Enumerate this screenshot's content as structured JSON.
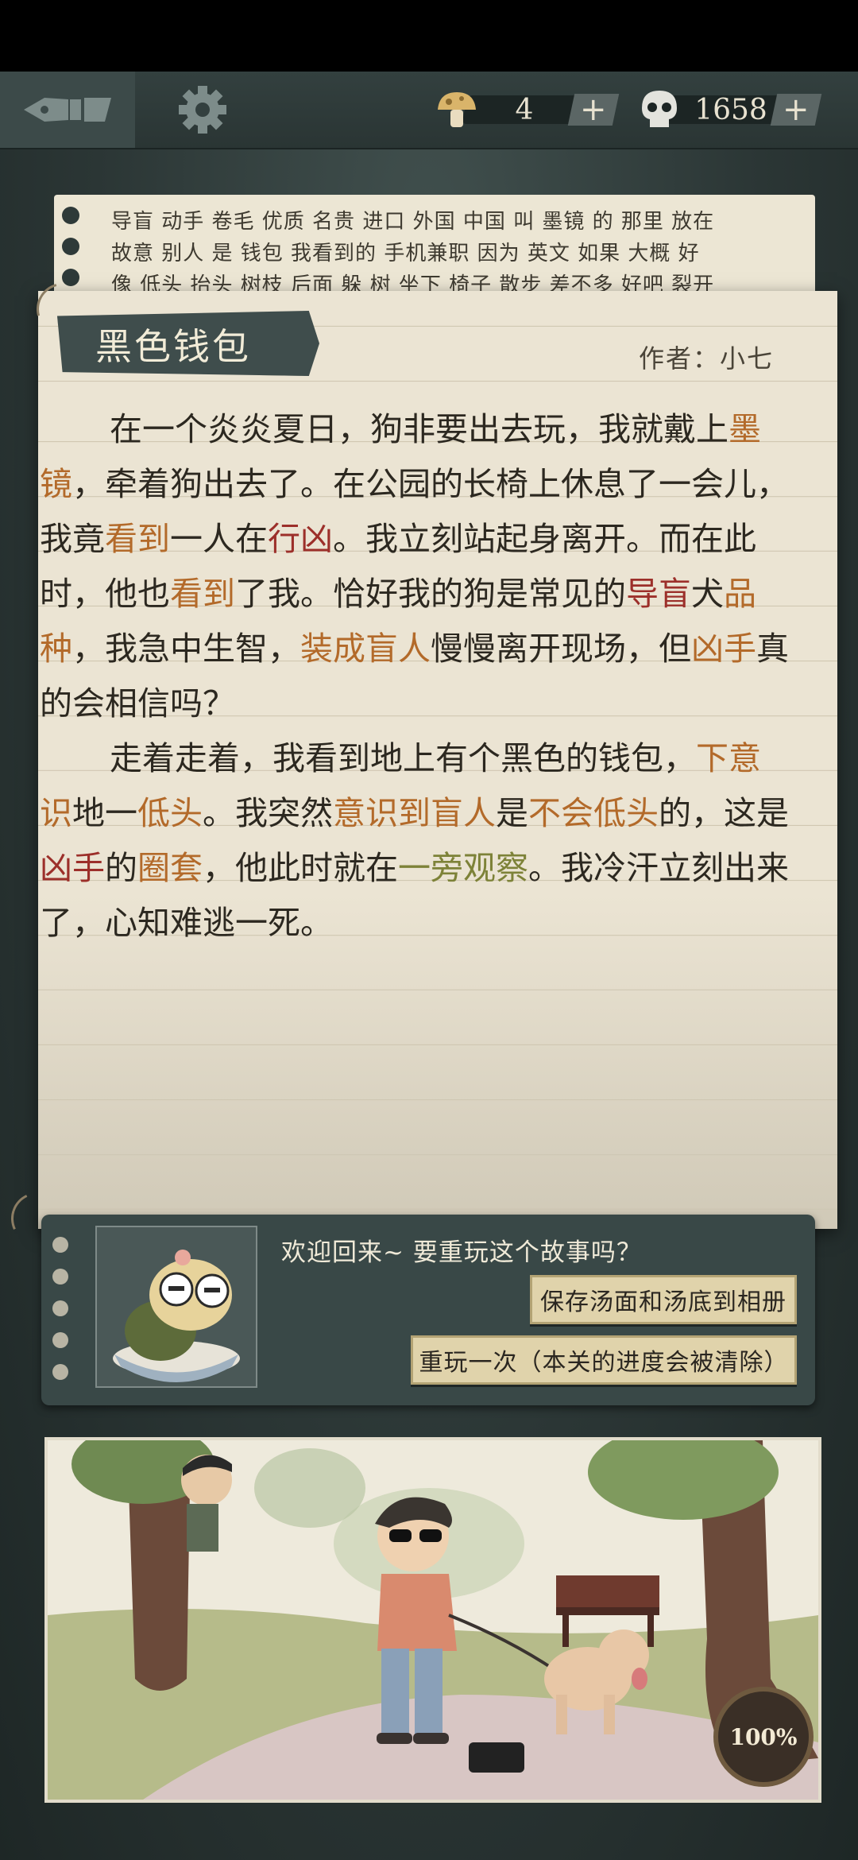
{
  "header": {
    "currency_a": {
      "icon": "mushroom-icon",
      "value": "4"
    },
    "currency_b": {
      "icon": "skull-icon",
      "value": "1658"
    },
    "plus_symbol": "+"
  },
  "word_card": {
    "line1": "导盲 动手 卷毛 优质 名贵 进口 外国 中国 叫 墨镜 的 那里 放在",
    "line2": "故意 别人 是 钱包 我看到的 手机兼职 因为 英文 如果 大概 好",
    "line3": "像 低头 抬头 树枝 后面 躲 树 坐下 椅子 散步 差不多 好吧 裂开"
  },
  "story": {
    "title": "黑色钱包",
    "author": "作者：小七",
    "p1": [
      {
        "t": "在一个炎炎夏日，狗非要出去玩，我就戴上",
        "c": ""
      },
      {
        "t": "墨镜",
        "c": "hl"
      },
      {
        "t": "，牵着狗出去了。在公园的长椅上休息了一会儿，我竟",
        "c": ""
      },
      {
        "t": "看到",
        "c": "hl"
      },
      {
        "t": "一人在",
        "c": ""
      },
      {
        "t": "行凶",
        "c": "hd"
      },
      {
        "t": "。我立刻站起身离开。而在此时，他也",
        "c": ""
      },
      {
        "t": "看到",
        "c": "hl"
      },
      {
        "t": "了我。恰好我的狗是常见的",
        "c": ""
      },
      {
        "t": "导盲",
        "c": "hd"
      },
      {
        "t": "犬",
        "c": ""
      },
      {
        "t": "品种",
        "c": "hl"
      },
      {
        "t": "，我急中生智，",
        "c": ""
      },
      {
        "t": "装成盲人",
        "c": "hl"
      },
      {
        "t": "慢慢离开现场，但",
        "c": ""
      },
      {
        "t": "凶手",
        "c": "hl"
      },
      {
        "t": "真的会相信吗？",
        "c": ""
      }
    ],
    "p2": [
      {
        "t": "走着走着，我看到地上有个黑色的钱包，",
        "c": ""
      },
      {
        "t": "下意识",
        "c": "hl"
      },
      {
        "t": "地一",
        "c": ""
      },
      {
        "t": "低头",
        "c": "hl"
      },
      {
        "t": "。我突然",
        "c": ""
      },
      {
        "t": "意识到盲人",
        "c": "hl"
      },
      {
        "t": "是",
        "c": ""
      },
      {
        "t": "不会低头",
        "c": "hl"
      },
      {
        "t": "的，这是",
        "c": ""
      },
      {
        "t": "凶手",
        "c": "hd"
      },
      {
        "t": "的",
        "c": ""
      },
      {
        "t": "圈套",
        "c": "hl"
      },
      {
        "t": "，他此时就在",
        "c": ""
      },
      {
        "t": "一旁观察",
        "c": "hg"
      },
      {
        "t": "。我冷汗立刻出来了，心知难逃一死。",
        "c": ""
      }
    ]
  },
  "dialog": {
    "message": "欢迎回来~ 要重玩这个故事吗？",
    "save_button": "保存汤面和汤底到相册",
    "replay_button": "重玩一次（本关的进度会被清除）"
  },
  "scene": {
    "progress_label": "100%",
    "progress": 1.0
  }
}
